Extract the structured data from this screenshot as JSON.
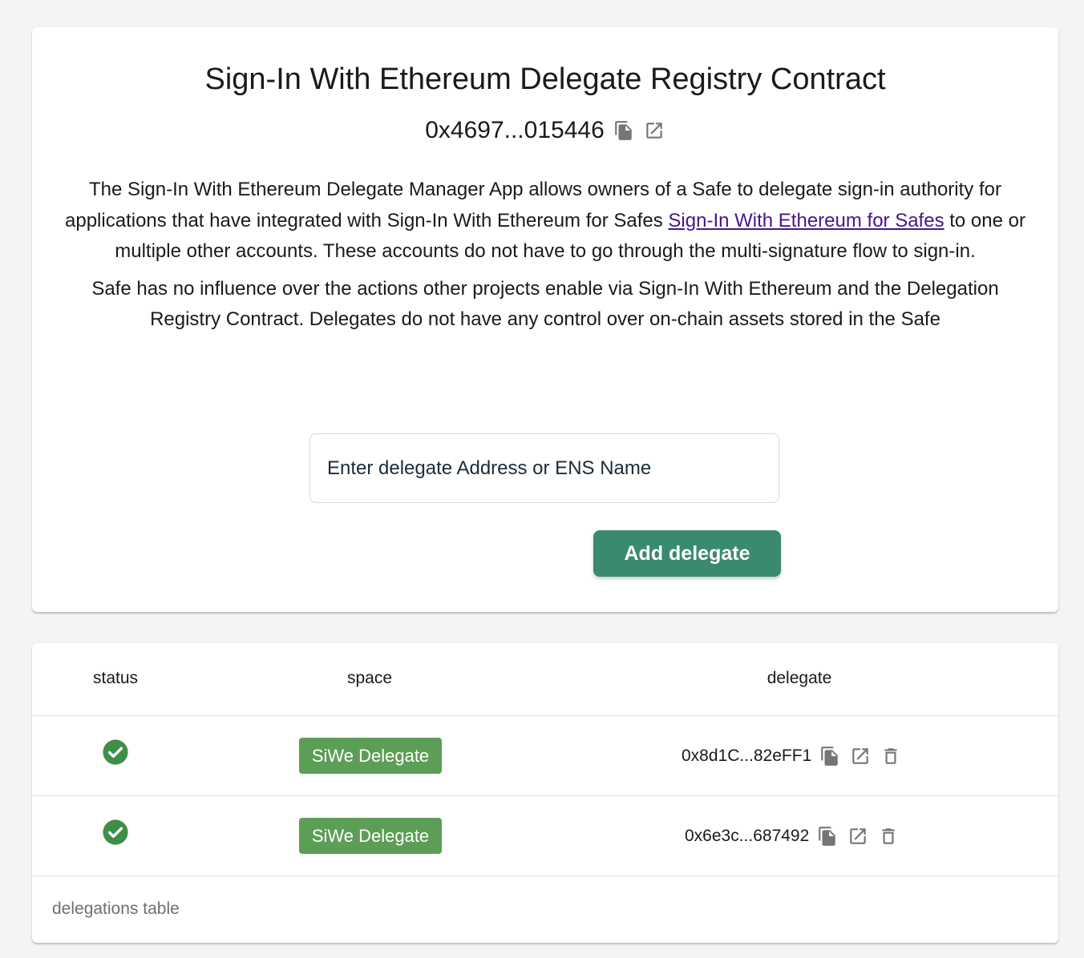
{
  "header": {
    "title": "Sign-In With Ethereum Delegate Registry Contract",
    "contract_address": "0x4697...015446",
    "copy_icon": "copy-icon",
    "external_link_icon": "external-link-icon"
  },
  "description": {
    "p1_before_link": "The Sign-In With Ethereum Delegate Manager App allows owners of a Safe to delegate sign-in authority for applications that have integrated with Sign-In With Ethereum for Safes ",
    "p1_link": "Sign-In With Ethereum for Safes",
    "p1_after_link": " to one or multiple other accounts. These accounts do not have to go through the multi-signature flow to sign-in.",
    "p2": "Safe has no influence over the actions other projects enable via Sign-In With Ethereum and the Delegation Registry Contract. Delegates do not have any control over on-chain assets stored in the Safe"
  },
  "form": {
    "input_placeholder": "Enter delegate Address or ENS Name",
    "input_value": "",
    "add_button_label": "Add delegate"
  },
  "table": {
    "columns": [
      "status",
      "space",
      "delegate"
    ],
    "rows": [
      {
        "status": "check-circle-icon",
        "space": "SiWe Delegate",
        "delegate": "0x8d1C...82eFF1"
      },
      {
        "status": "check-circle-icon",
        "space": "SiWe Delegate",
        "delegate": "0x6e3c...687492"
      }
    ],
    "caption": "delegations table"
  },
  "colors": {
    "background": "#f4f4f4",
    "primary_button": "#3a8a72",
    "chip": "#5c9e55",
    "status_ok": "#3d8f48",
    "link": "#4a148c",
    "icon": "#757575"
  }
}
